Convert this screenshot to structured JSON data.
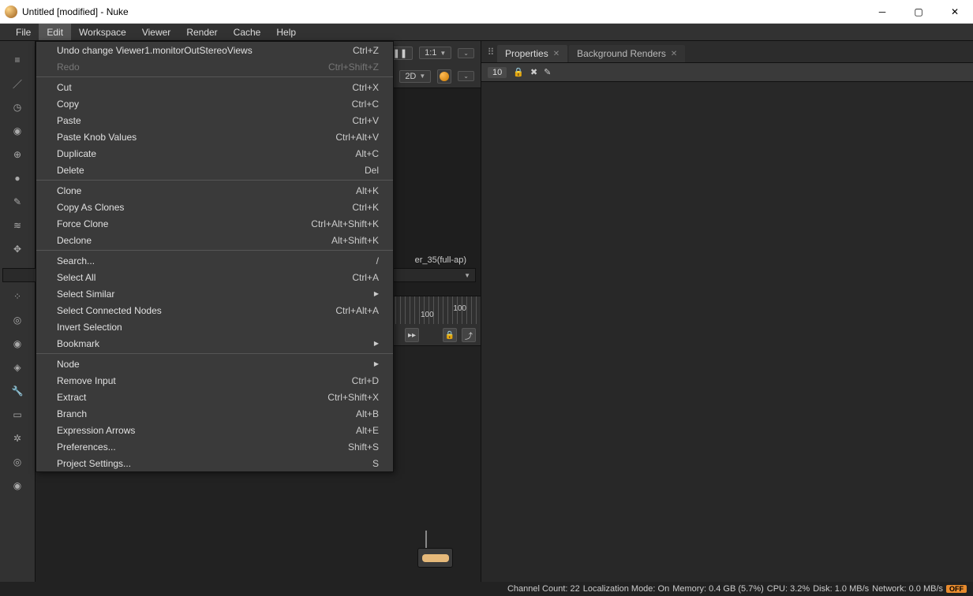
{
  "window": {
    "title": "Untitled [modified] - Nuke"
  },
  "menubar": [
    "File",
    "Edit",
    "Workspace",
    "Viewer",
    "Render",
    "Cache",
    "Help"
  ],
  "active_menu_index": 1,
  "edit_menu": [
    {
      "label": "Undo change Viewer1.monitorOutStereoViews",
      "shortcut": "Ctrl+Z"
    },
    {
      "label": "Redo",
      "shortcut": "Ctrl+Shift+Z",
      "disabled": true
    },
    {
      "sep": true
    },
    {
      "label": "Cut",
      "shortcut": "Ctrl+X"
    },
    {
      "label": "Copy",
      "shortcut": "Ctrl+C"
    },
    {
      "label": "Paste",
      "shortcut": "Ctrl+V"
    },
    {
      "label": "Paste Knob Values",
      "shortcut": "Ctrl+Alt+V"
    },
    {
      "label": "Duplicate",
      "shortcut": "Alt+C"
    },
    {
      "label": "Delete",
      "shortcut": "Del"
    },
    {
      "sep": true
    },
    {
      "label": "Clone",
      "shortcut": "Alt+K"
    },
    {
      "label": "Copy As Clones",
      "shortcut": "Ctrl+K"
    },
    {
      "label": "Force Clone",
      "shortcut": "Ctrl+Alt+Shift+K"
    },
    {
      "label": "Declone",
      "shortcut": "Alt+Shift+K"
    },
    {
      "sep": true
    },
    {
      "label": "Search...",
      "shortcut": "/"
    },
    {
      "label": "Select All",
      "shortcut": "Ctrl+A"
    },
    {
      "label": "Select Similar",
      "submenu": true
    },
    {
      "label": "Select Connected Nodes",
      "shortcut": "Ctrl+Alt+A"
    },
    {
      "label": "Invert Selection"
    },
    {
      "label": "Bookmark",
      "submenu": true
    },
    {
      "sep": true
    },
    {
      "label": "Node",
      "submenu": true
    },
    {
      "label": "Remove Input",
      "shortcut": "Ctrl+D"
    },
    {
      "label": "Extract",
      "shortcut": "Ctrl+Shift+X"
    },
    {
      "label": "Branch",
      "shortcut": "Alt+B"
    },
    {
      "label": "Expression Arrows",
      "shortcut": "Alt+E"
    },
    {
      "label": "Preferences...",
      "shortcut": "Shift+S"
    },
    {
      "label": "Project Settings...",
      "shortcut": "S"
    }
  ],
  "right_panel": {
    "tabs": [
      "Properties",
      "Background Renders"
    ],
    "active_tab": 0,
    "prop_count": "10"
  },
  "viewer": {
    "zoom": "1:1",
    "mode": "2D",
    "format_suffix": "er_35(full-ap)",
    "timeline_center_label": "100",
    "timeline_right_label": "100"
  },
  "status": {
    "channel_count_label": "Channel Count:",
    "channel_count": "22",
    "localization_label": "Localization Mode:",
    "localization": "On",
    "memory_label": "Memory:",
    "memory": "0.4 GB (5.7%)",
    "cpu_label": "CPU:",
    "cpu": "3.2%",
    "disk_label": "Disk:",
    "disk": "1.0 MB/s",
    "network_label": "Network:",
    "network": "0.0 MB/s",
    "off_badge": "OFF"
  },
  "toolstrip_icons": [
    "hamburger-icon",
    "brush-icon",
    "clock-icon",
    "rings-icon",
    "globe-icon",
    "sphere-icon",
    "wand-icon",
    "layers-icon",
    "move-icon",
    "cube-icon",
    "dots-icon",
    "ring-d-icon",
    "eye-icon",
    "tag-icon",
    "wrench-icon",
    "monitor-icon",
    "flower-icon",
    "target-icon",
    "radar-icon"
  ]
}
